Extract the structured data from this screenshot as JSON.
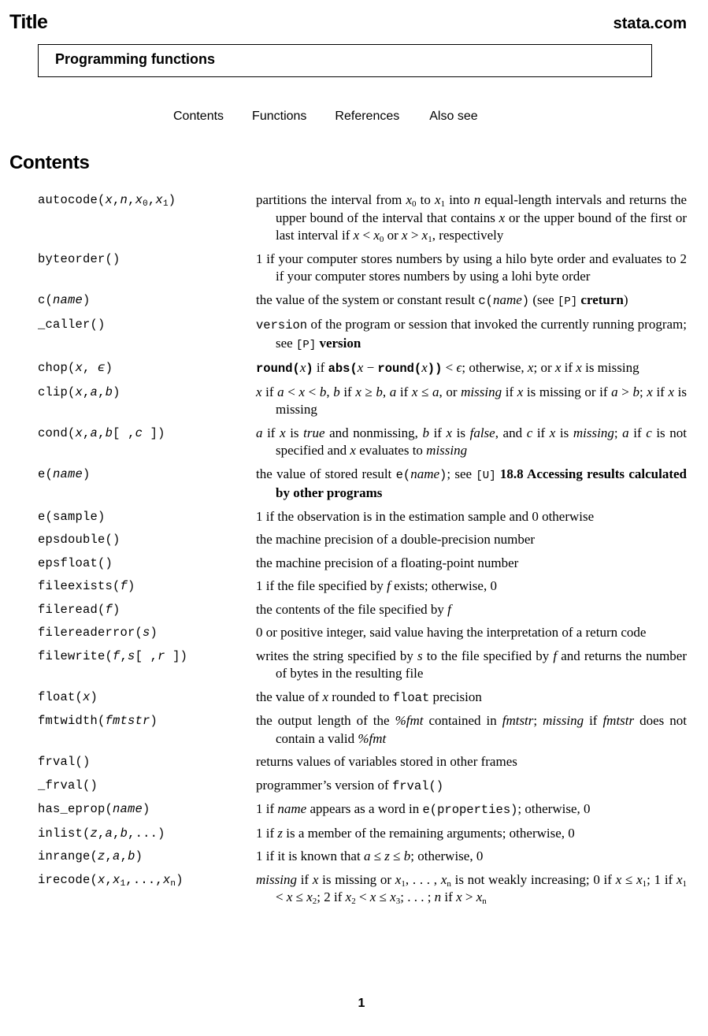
{
  "header": {
    "title": "Title",
    "site": "stata.com"
  },
  "entry_title": "Programming functions",
  "toc": [
    "Contents",
    "Functions",
    "References",
    "Also see"
  ],
  "section_title": "Contents",
  "page_number": "1",
  "entries": [
    {
      "fn": [
        [
          "t",
          "autocode("
        ],
        [
          "i",
          "x"
        ],
        [
          "t",
          ","
        ],
        [
          "i",
          "n"
        ],
        [
          "t",
          ","
        ],
        [
          "i",
          "x"
        ],
        [
          "sub",
          "0"
        ],
        [
          "t",
          ","
        ],
        [
          "i",
          "x"
        ],
        [
          "sub",
          "1"
        ],
        [
          "t",
          ")"
        ]
      ],
      "desc": [
        [
          "r",
          "partitions the interval from "
        ],
        [
          "i",
          "x"
        ],
        [
          "sub",
          "0"
        ],
        [
          "r",
          " to "
        ],
        [
          "i",
          "x"
        ],
        [
          "sub",
          "1"
        ],
        [
          "r",
          " into "
        ],
        [
          "i",
          "n"
        ],
        [
          "r",
          " equal-length intervals and returns the upper bound of the interval that contains "
        ],
        [
          "i",
          "x"
        ],
        [
          "r",
          " or the upper bound of the first or last interval if "
        ],
        [
          "i",
          "x"
        ],
        [
          "r",
          " < "
        ],
        [
          "i",
          "x"
        ],
        [
          "sub",
          "0"
        ],
        [
          "r",
          " or "
        ],
        [
          "i",
          "x"
        ],
        [
          "r",
          " > "
        ],
        [
          "i",
          "x"
        ],
        [
          "sub",
          "1"
        ],
        [
          "r",
          ", respectively"
        ]
      ]
    },
    {
      "fn": [
        [
          "t",
          "byteorder()"
        ]
      ],
      "desc": [
        [
          "r",
          "1 if your computer stores numbers by using a hilo byte order and evaluates to 2 if your computer stores numbers by using a lohi byte order"
        ]
      ]
    },
    {
      "fn": [
        [
          "t",
          "c("
        ],
        [
          "i",
          "name"
        ],
        [
          "t",
          ")"
        ]
      ],
      "desc": [
        [
          "r",
          "the value of the system or constant result "
        ],
        [
          "t",
          "c("
        ],
        [
          "i",
          "name"
        ],
        [
          "t",
          ")"
        ],
        [
          "r",
          " (see "
        ],
        [
          "ref",
          "[P]"
        ],
        [
          "r",
          " "
        ],
        [
          "b",
          "creturn"
        ],
        [
          "r",
          ")"
        ]
      ]
    },
    {
      "fn": [
        [
          "t",
          "_caller()"
        ]
      ],
      "desc": [
        [
          "t",
          "version"
        ],
        [
          "r",
          " of the program or session that invoked the currently running program; see "
        ],
        [
          "ref",
          "[P]"
        ],
        [
          "r",
          " "
        ],
        [
          "b",
          "version"
        ]
      ]
    },
    {
      "fn": [
        [
          "t",
          "chop("
        ],
        [
          "i",
          "x"
        ],
        [
          "t",
          ", "
        ],
        [
          "i",
          "ϵ"
        ],
        [
          "t",
          ")"
        ]
      ],
      "desc": [
        [
          "tb",
          "round("
        ],
        [
          "i",
          "x"
        ],
        [
          "tb",
          ")"
        ],
        [
          "r",
          " if "
        ],
        [
          "tb",
          "abs("
        ],
        [
          "i",
          "x"
        ],
        [
          "r",
          " − "
        ],
        [
          "tb",
          "round("
        ],
        [
          "i",
          "x"
        ],
        [
          "tb",
          "))"
        ],
        [
          "r",
          " < "
        ],
        [
          "i",
          "ϵ"
        ],
        [
          "r",
          "; otherwise, "
        ],
        [
          "i",
          "x"
        ],
        [
          "r",
          "; or "
        ],
        [
          "i",
          "x"
        ],
        [
          "r",
          " if "
        ],
        [
          "i",
          "x"
        ],
        [
          "r",
          " is missing"
        ]
      ]
    },
    {
      "fn": [
        [
          "t",
          "clip("
        ],
        [
          "i",
          "x"
        ],
        [
          "t",
          ","
        ],
        [
          "i",
          "a"
        ],
        [
          "t",
          ","
        ],
        [
          "i",
          "b"
        ],
        [
          "t",
          ")"
        ]
      ],
      "desc": [
        [
          "i",
          "x"
        ],
        [
          "r",
          " if "
        ],
        [
          "i",
          "a"
        ],
        [
          "r",
          " < "
        ],
        [
          "i",
          "x"
        ],
        [
          "r",
          " < "
        ],
        [
          "i",
          "b"
        ],
        [
          "r",
          ", "
        ],
        [
          "i",
          "b"
        ],
        [
          "r",
          " if "
        ],
        [
          "i",
          "x"
        ],
        [
          "r",
          " ≥ "
        ],
        [
          "i",
          "b"
        ],
        [
          "r",
          ", "
        ],
        [
          "i",
          "a"
        ],
        [
          "r",
          " if "
        ],
        [
          "i",
          "x"
        ],
        [
          "r",
          " ≤ "
        ],
        [
          "i",
          "a"
        ],
        [
          "r",
          ", or "
        ],
        [
          "i",
          "missing"
        ],
        [
          "r",
          " if "
        ],
        [
          "i",
          "x"
        ],
        [
          "r",
          " is missing or if "
        ],
        [
          "i",
          "a"
        ],
        [
          "r",
          " > "
        ],
        [
          "i",
          "b"
        ],
        [
          "r",
          "; "
        ],
        [
          "i",
          "x"
        ],
        [
          "r",
          " if "
        ],
        [
          "i",
          "x"
        ],
        [
          "r",
          " is missing"
        ]
      ]
    },
    {
      "fn": [
        [
          "t",
          "cond("
        ],
        [
          "i",
          "x"
        ],
        [
          "t",
          ","
        ],
        [
          "i",
          "a"
        ],
        [
          "t",
          ","
        ],
        [
          "i",
          "b"
        ],
        [
          "t",
          "[ ,"
        ],
        [
          "i",
          "c"
        ],
        [
          "t",
          " ])"
        ]
      ],
      "desc": [
        [
          "i",
          "a"
        ],
        [
          "r",
          " if "
        ],
        [
          "i",
          "x"
        ],
        [
          "r",
          " is "
        ],
        [
          "i",
          "true"
        ],
        [
          "r",
          " and nonmissing, "
        ],
        [
          "i",
          "b"
        ],
        [
          "r",
          " if "
        ],
        [
          "i",
          "x"
        ],
        [
          "r",
          " is "
        ],
        [
          "i",
          "false"
        ],
        [
          "r",
          ", and "
        ],
        [
          "i",
          "c"
        ],
        [
          "r",
          " if "
        ],
        [
          "i",
          "x"
        ],
        [
          "r",
          " is "
        ],
        [
          "i",
          "missing"
        ],
        [
          "r",
          "; "
        ],
        [
          "i",
          "a"
        ],
        [
          "r",
          " if "
        ],
        [
          "i",
          "c"
        ],
        [
          "r",
          " is not specified and "
        ],
        [
          "i",
          "x"
        ],
        [
          "r",
          " evaluates to "
        ],
        [
          "i",
          "missing"
        ]
      ]
    },
    {
      "fn": [
        [
          "t",
          "e("
        ],
        [
          "i",
          "name"
        ],
        [
          "t",
          ")"
        ]
      ],
      "desc": [
        [
          "r",
          "the value of stored result "
        ],
        [
          "t",
          "e("
        ],
        [
          "i",
          "name"
        ],
        [
          "t",
          ")"
        ],
        [
          "r",
          "; see "
        ],
        [
          "ref",
          "[U]"
        ],
        [
          "r",
          " "
        ],
        [
          "b",
          "18.8 Accessing results calculated by other programs"
        ]
      ]
    },
    {
      "fn": [
        [
          "t",
          "e(sample)"
        ]
      ],
      "desc": [
        [
          "r",
          "1 if the observation is in the estimation sample and 0 otherwise"
        ]
      ]
    },
    {
      "fn": [
        [
          "t",
          "epsdouble()"
        ]
      ],
      "desc": [
        [
          "r",
          "the machine precision of a double-precision number"
        ]
      ]
    },
    {
      "fn": [
        [
          "t",
          "epsfloat()"
        ]
      ],
      "desc": [
        [
          "r",
          "the machine precision of a floating-point number"
        ]
      ]
    },
    {
      "fn": [
        [
          "t",
          "fileexists("
        ],
        [
          "i",
          "f"
        ],
        [
          "t",
          ")"
        ]
      ],
      "desc": [
        [
          "r",
          "1 if the file specified by "
        ],
        [
          "i",
          "f"
        ],
        [
          "r",
          " exists; otherwise, 0"
        ]
      ]
    },
    {
      "fn": [
        [
          "t",
          "fileread("
        ],
        [
          "i",
          "f"
        ],
        [
          "t",
          ")"
        ]
      ],
      "desc": [
        [
          "r",
          "the contents of the file specified by "
        ],
        [
          "i",
          "f"
        ]
      ]
    },
    {
      "fn": [
        [
          "t",
          "filereaderror("
        ],
        [
          "i",
          "s"
        ],
        [
          "t",
          ")"
        ]
      ],
      "desc": [
        [
          "r",
          "0 or positive integer, said value having the interpretation of a return code"
        ]
      ]
    },
    {
      "fn": [
        [
          "t",
          "filewrite("
        ],
        [
          "i",
          "f"
        ],
        [
          "t",
          ","
        ],
        [
          "i",
          "s"
        ],
        [
          "t",
          "[ ,"
        ],
        [
          "i",
          "r"
        ],
        [
          "t",
          " ])"
        ]
      ],
      "desc": [
        [
          "r",
          "writes the string specified by "
        ],
        [
          "i",
          "s"
        ],
        [
          "r",
          " to the file specified by "
        ],
        [
          "i",
          "f"
        ],
        [
          "r",
          " and returns the number of bytes in the resulting file"
        ]
      ]
    },
    {
      "fn": [
        [
          "t",
          "float("
        ],
        [
          "i",
          "x"
        ],
        [
          "t",
          ")"
        ]
      ],
      "desc": [
        [
          "r",
          "the value of "
        ],
        [
          "i",
          "x"
        ],
        [
          "r",
          " rounded to "
        ],
        [
          "t",
          "float"
        ],
        [
          "r",
          " precision"
        ]
      ]
    },
    {
      "fn": [
        [
          "t",
          "fmtwidth("
        ],
        [
          "i",
          "fmtstr"
        ],
        [
          "t",
          ")"
        ]
      ],
      "desc": [
        [
          "r",
          "the output length of the "
        ],
        [
          "i",
          "%fmt"
        ],
        [
          "r",
          " contained in "
        ],
        [
          "i",
          "fmtstr"
        ],
        [
          "r",
          "; "
        ],
        [
          "i",
          "missing"
        ],
        [
          "r",
          " if "
        ],
        [
          "i",
          "fmtstr"
        ],
        [
          "r",
          " does not contain a valid "
        ],
        [
          "i",
          "%fmt"
        ]
      ]
    },
    {
      "fn": [
        [
          "t",
          "frval()"
        ]
      ],
      "desc": [
        [
          "r",
          "returns values of variables stored in other frames"
        ]
      ]
    },
    {
      "fn": [
        [
          "t",
          "_frval()"
        ]
      ],
      "desc": [
        [
          "r",
          "programmer’s version of "
        ],
        [
          "t",
          "frval()"
        ]
      ]
    },
    {
      "fn": [
        [
          "t",
          "has_eprop("
        ],
        [
          "i",
          "name"
        ],
        [
          "t",
          ")"
        ]
      ],
      "desc": [
        [
          "r",
          "1 if "
        ],
        [
          "i",
          "name"
        ],
        [
          "r",
          " appears as a word in "
        ],
        [
          "t",
          "e(properties)"
        ],
        [
          "r",
          "; otherwise, 0"
        ]
      ]
    },
    {
      "fn": [
        [
          "t",
          "inlist("
        ],
        [
          "i",
          "z"
        ],
        [
          "t",
          ","
        ],
        [
          "i",
          "a"
        ],
        [
          "t",
          ","
        ],
        [
          "i",
          "b"
        ],
        [
          "t",
          ",...)"
        ]
      ],
      "desc": [
        [
          "r",
          "1 if "
        ],
        [
          "i",
          "z"
        ],
        [
          "r",
          " is a member of the remaining arguments; otherwise, 0"
        ]
      ]
    },
    {
      "fn": [
        [
          "t",
          "inrange("
        ],
        [
          "i",
          "z"
        ],
        [
          "t",
          ","
        ],
        [
          "i",
          "a"
        ],
        [
          "t",
          ","
        ],
        [
          "i",
          "b"
        ],
        [
          "t",
          ")"
        ]
      ],
      "desc": [
        [
          "r",
          "1 if it is known that "
        ],
        [
          "i",
          "a"
        ],
        [
          "r",
          " ≤ "
        ],
        [
          "i",
          "z"
        ],
        [
          "r",
          " ≤ "
        ],
        [
          "i",
          "b"
        ],
        [
          "r",
          "; otherwise, 0"
        ]
      ]
    },
    {
      "fn": [
        [
          "t",
          "irecode("
        ],
        [
          "i",
          "x"
        ],
        [
          "t",
          ","
        ],
        [
          "i",
          "x"
        ],
        [
          "sub",
          "1"
        ],
        [
          "t",
          ",...,"
        ],
        [
          "i",
          "x"
        ],
        [
          "sub",
          "n"
        ],
        [
          "t",
          ")"
        ]
      ],
      "desc": [
        [
          "i",
          "missing"
        ],
        [
          "r",
          " if "
        ],
        [
          "i",
          "x"
        ],
        [
          "r",
          " is missing or "
        ],
        [
          "i",
          "x"
        ],
        [
          "sub",
          "1"
        ],
        [
          "r",
          ", . . . , "
        ],
        [
          "i",
          "x"
        ],
        [
          "sub",
          "n"
        ],
        [
          "r",
          " is not weakly increasing; 0 if "
        ],
        [
          "i",
          "x"
        ],
        [
          "r",
          " ≤ "
        ],
        [
          "i",
          "x"
        ],
        [
          "sub",
          "1"
        ],
        [
          "r",
          "; 1 if "
        ],
        [
          "i",
          "x"
        ],
        [
          "sub",
          "1"
        ],
        [
          "r",
          " < "
        ],
        [
          "i",
          "x"
        ],
        [
          "r",
          " ≤ "
        ],
        [
          "i",
          "x"
        ],
        [
          "sub",
          "2"
        ],
        [
          "r",
          "; 2 if "
        ],
        [
          "i",
          "x"
        ],
        [
          "sub",
          "2"
        ],
        [
          "r",
          " < "
        ],
        [
          "i",
          "x"
        ],
        [
          "r",
          " ≤ "
        ],
        [
          "i",
          "x"
        ],
        [
          "sub",
          "3"
        ],
        [
          "r",
          "; . . . ; "
        ],
        [
          "i",
          "n"
        ],
        [
          "r",
          " if "
        ],
        [
          "i",
          "x"
        ],
        [
          "r",
          " > "
        ],
        [
          "i",
          "x"
        ],
        [
          "sub",
          "n"
        ]
      ]
    }
  ]
}
